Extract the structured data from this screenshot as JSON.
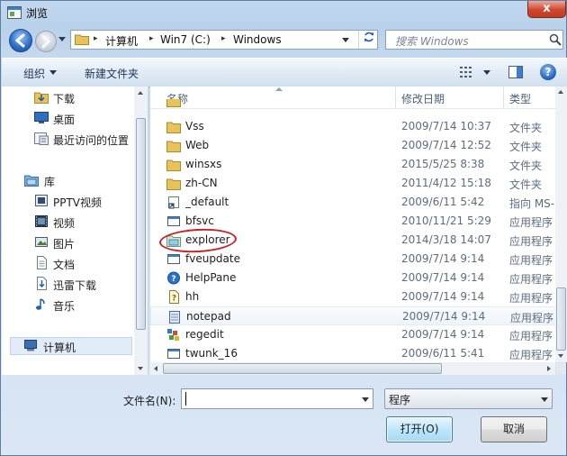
{
  "window": {
    "title": "浏览",
    "close_label": "x"
  },
  "address": {
    "crumbs": [
      "计算机",
      "Win7 (C:)",
      "Windows"
    ]
  },
  "search": {
    "placeholder": "搜索 Windows"
  },
  "toolbar": {
    "organize_label": "组织",
    "new_folder_label": "新建文件夹",
    "help_label": "?"
  },
  "nav": {
    "items": [
      {
        "label": "下载",
        "icon": "download-folder-icon"
      },
      {
        "label": "桌面",
        "icon": "desktop-icon"
      },
      {
        "label": "最近访问的位置",
        "icon": "recent-places-icon"
      },
      {
        "label": "库",
        "icon": "library-icon"
      },
      {
        "label": "PPTV视频",
        "icon": "video-library-icon"
      },
      {
        "label": "视频",
        "icon": "video-library-icon"
      },
      {
        "label": "图片",
        "icon": "pictures-library-icon"
      },
      {
        "label": "文档",
        "icon": "documents-library-icon"
      },
      {
        "label": "迅雷下载",
        "icon": "download-library-icon"
      },
      {
        "label": "音乐",
        "icon": "music-library-icon"
      },
      {
        "label": "计算机",
        "icon": "computer-icon"
      }
    ]
  },
  "columns": {
    "name": "名称",
    "date": "修改日期",
    "type": "类型"
  },
  "files": [
    {
      "name": "Vss",
      "date": "2009/7/14 10:37",
      "type": "文件夹",
      "icon": "folder-icon"
    },
    {
      "name": "Web",
      "date": "2009/7/14 12:52",
      "type": "文件夹",
      "icon": "folder-icon"
    },
    {
      "name": "winsxs",
      "date": "2015/5/25 8:38",
      "type": "文件夹",
      "icon": "folder-icon"
    },
    {
      "name": "zh-CN",
      "date": "2011/4/12 15:18",
      "type": "文件夹",
      "icon": "folder-icon"
    },
    {
      "name": "_default",
      "date": "2009/6/11 5:42",
      "type": "指向 MS-",
      "icon": "shortcut-icon"
    },
    {
      "name": "bfsvc",
      "date": "2010/11/21 5:29",
      "type": "应用程序",
      "icon": "app-icon"
    },
    {
      "name": "explorer",
      "date": "2014/3/18 14:07",
      "type": "应用程序",
      "icon": "explorer-folder-icon"
    },
    {
      "name": "fveupdate",
      "date": "2009/7/14 9:14",
      "type": "应用程序",
      "icon": "app-icon"
    },
    {
      "name": "HelpPane",
      "date": "2009/7/14 9:14",
      "type": "应用程序",
      "icon": "help-app-icon"
    },
    {
      "name": "hh",
      "date": "2009/7/14 9:14",
      "type": "应用程序",
      "icon": "help-doc-icon"
    },
    {
      "name": "notepad",
      "date": "2009/7/14 9:14",
      "type": "应用程序",
      "icon": "notepad-icon"
    },
    {
      "name": "regedit",
      "date": "2009/7/14 9:14",
      "type": "应用程序",
      "icon": "regedit-icon"
    },
    {
      "name": "twunk_16",
      "date": "2009/6/11 5:41",
      "type": "应用程序",
      "icon": "app-icon"
    }
  ],
  "bottom": {
    "filename_label": "文件名(N):",
    "filename_value": "",
    "filetype_value": "程序",
    "open_label": "打开(O)",
    "cancel_label": "取消"
  },
  "colors": {
    "accent": "#1d5fb4",
    "highlight_circle": "#c5242a",
    "folder": "#e8c35a"
  }
}
